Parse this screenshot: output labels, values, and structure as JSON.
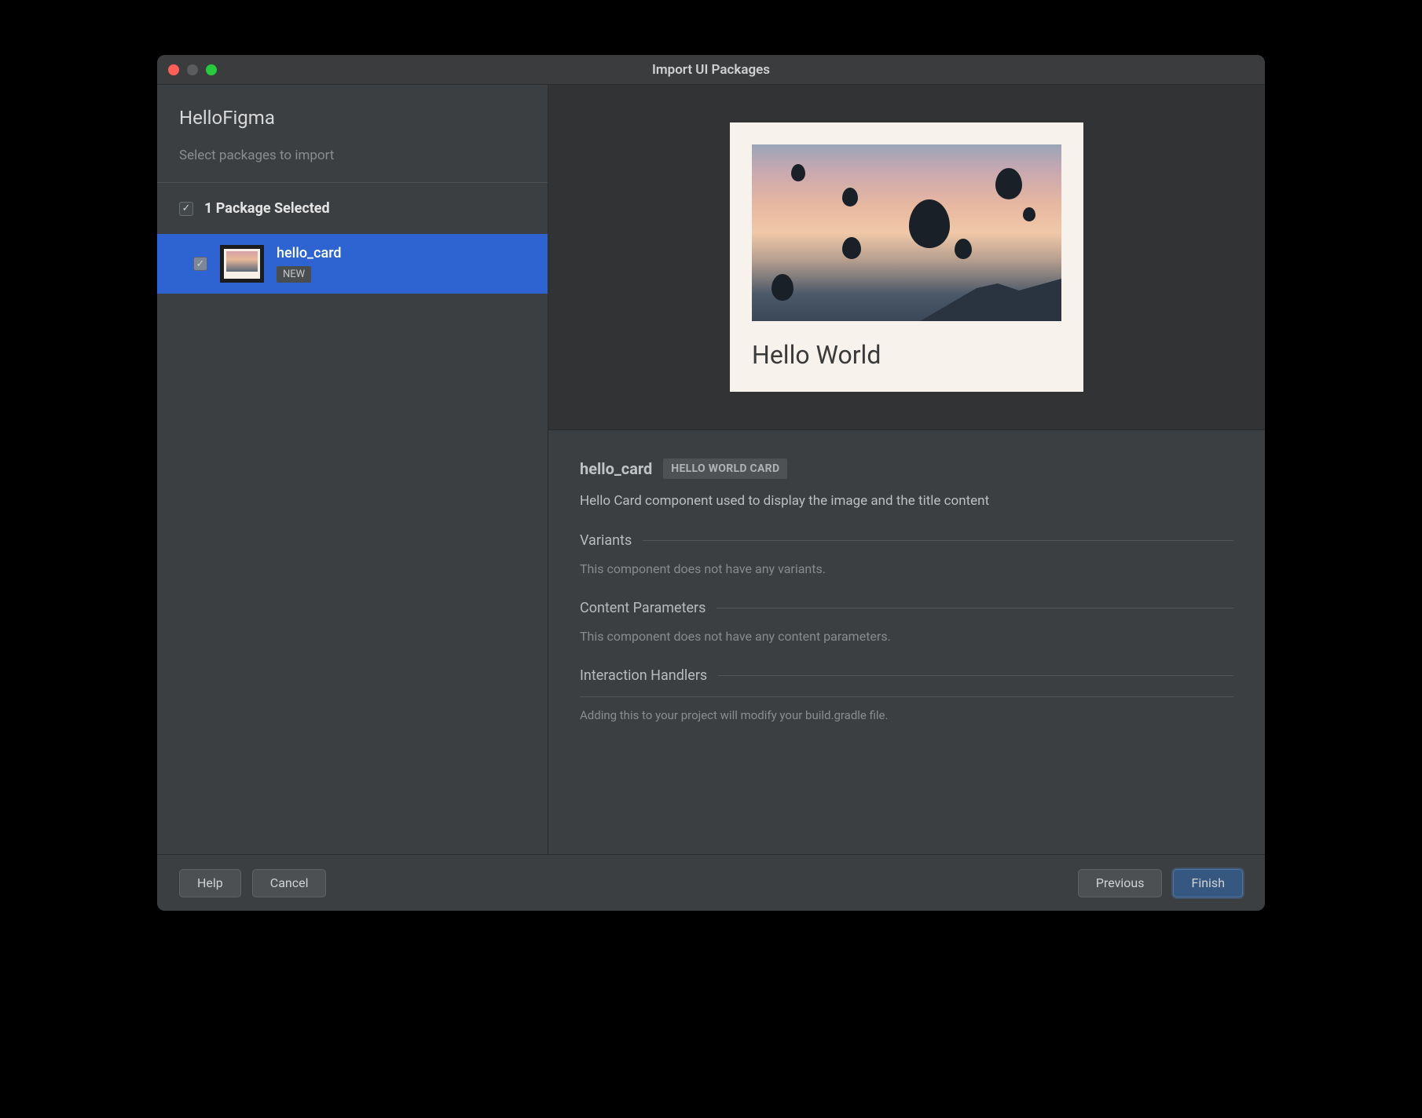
{
  "window": {
    "title": "Import UI Packages"
  },
  "sidebar": {
    "project_title": "HelloFigma",
    "subtitle": "Select packages to import",
    "count_label": "1 Package Selected",
    "items": [
      {
        "name": "hello_card",
        "badge": "NEW",
        "checked": true
      }
    ]
  },
  "preview": {
    "card_title": "Hello World"
  },
  "details": {
    "name": "hello_card",
    "badge": "HELLO WORLD CARD",
    "description": "Hello Card component used to display the image and the title content",
    "sections": {
      "variants": {
        "title": "Variants",
        "body": "This component does not have any variants."
      },
      "content_parameters": {
        "title": "Content Parameters",
        "body": "This component does not have any content parameters."
      },
      "interaction_handlers": {
        "title": "Interaction Handlers"
      }
    },
    "footer_note": "Adding this to your project will modify your build.gradle file."
  },
  "buttons": {
    "help": "Help",
    "cancel": "Cancel",
    "previous": "Previous",
    "finish": "Finish"
  }
}
